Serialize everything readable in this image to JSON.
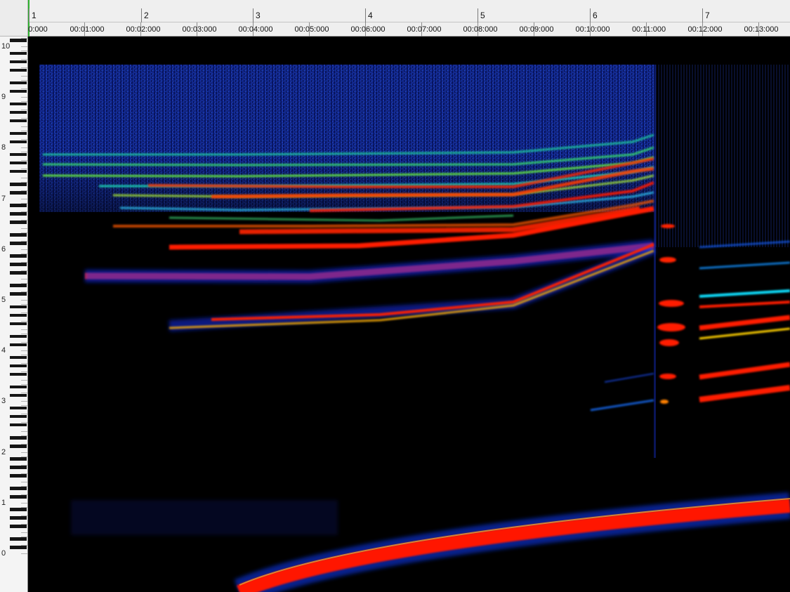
{
  "ruler": {
    "bars": [
      "1",
      "2",
      "3",
      "4",
      "5",
      "6",
      "7"
    ],
    "times": [
      "0:000",
      "00:01:000",
      "00:02:000",
      "00:03:000",
      "00:04:000",
      "00:05:000",
      "00:06:000",
      "00:07:000",
      "00:08:000",
      "00:09:000",
      "00:10:000",
      "00:11:000",
      "00:12:000",
      "00:13:000"
    ]
  },
  "keyboard": {
    "octave_labels": [
      "10",
      "9",
      "8",
      "7",
      "6",
      "5",
      "4",
      "3",
      "2",
      "1",
      "0"
    ]
  },
  "colors": {
    "background": "#000000",
    "ruler_bg": "#efefef",
    "playhead": "#2fb22f",
    "spectrum_low": "#0a1a8a",
    "spectrum_mid": "#00e0a0",
    "spectrum_high": "#ff1400"
  }
}
